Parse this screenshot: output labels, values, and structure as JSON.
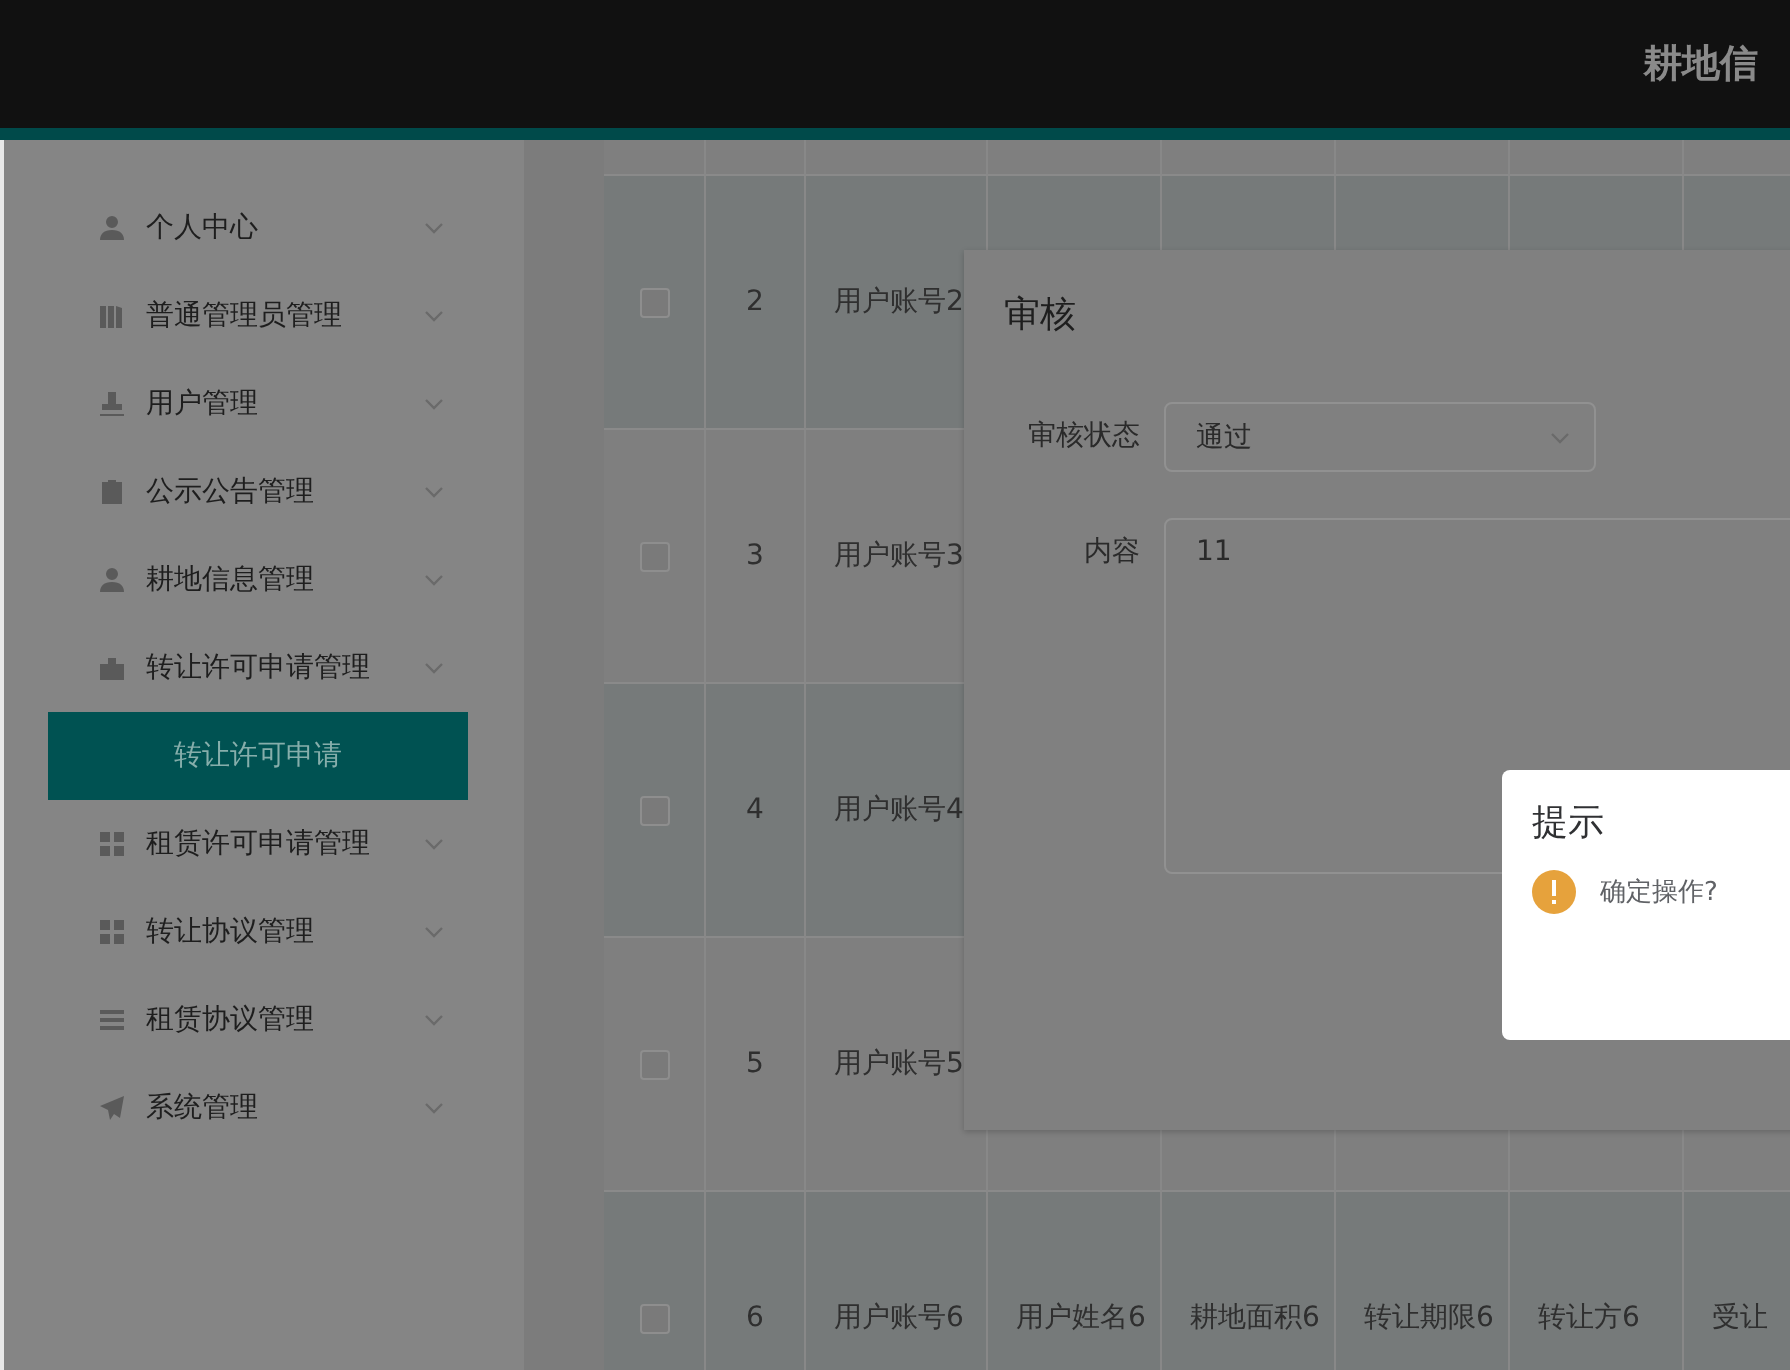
{
  "header": {
    "title": "耕地信"
  },
  "sidebar": {
    "items": [
      {
        "label": "个人中心"
      },
      {
        "label": "普通管理员管理"
      },
      {
        "label": "用户管理"
      },
      {
        "label": "公示公告管理"
      },
      {
        "label": "耕地信息管理"
      },
      {
        "label": "转让许可申请管理",
        "children": [
          {
            "label": "转让许可申请",
            "selected": true
          }
        ]
      },
      {
        "label": "租赁许可申请管理"
      },
      {
        "label": "转让协议管理"
      },
      {
        "label": "租赁协议管理"
      },
      {
        "label": "系统管理"
      }
    ]
  },
  "table": {
    "rows": [
      {
        "checked": false,
        "index": "2",
        "cells": [
          "用户账号2"
        ]
      },
      {
        "checked": false,
        "index": "3",
        "cells": [
          "用户账号3"
        ]
      },
      {
        "checked": false,
        "index": "4",
        "cells": [
          "用户账号4"
        ]
      },
      {
        "checked": false,
        "index": "5",
        "cells": [
          "用户账号5"
        ]
      },
      {
        "checked": false,
        "index": "6",
        "cells": [
          "用户账号6",
          "用户姓名6",
          "耕地面积6",
          "转让期限6",
          "转让方6",
          "受让"
        ]
      }
    ]
  },
  "dialog": {
    "title": "审核",
    "fields": [
      {
        "kind": "select",
        "label": "审核状态",
        "value": "通过"
      },
      {
        "kind": "textarea",
        "label": "内容",
        "value": "11"
      }
    ]
  },
  "message_box": {
    "title": "提示",
    "message": "确定操作?"
  }
}
